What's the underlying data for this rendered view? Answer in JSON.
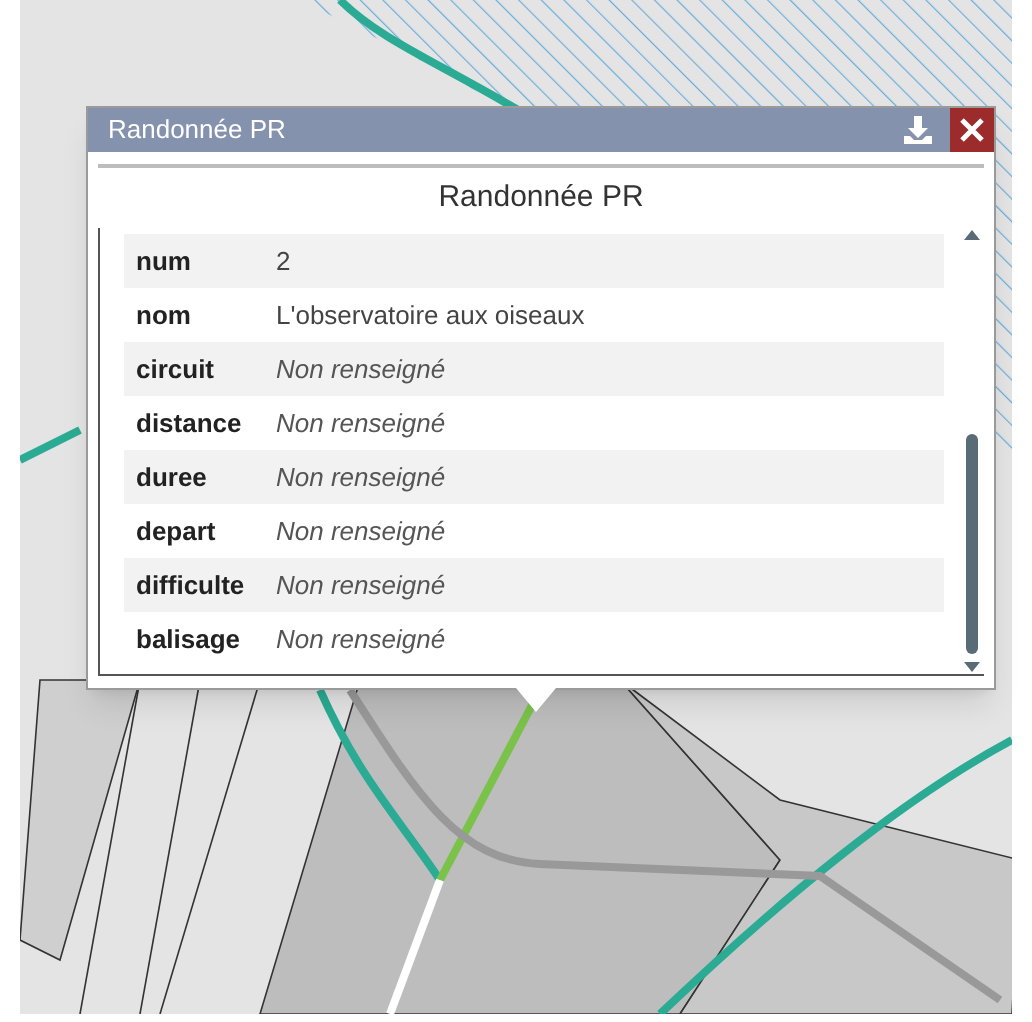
{
  "popup": {
    "title": "Randonnée PR",
    "heading": "Randonnée PR",
    "rows": [
      {
        "field": "num",
        "value": "2",
        "kind": "text"
      },
      {
        "field": "nom",
        "value": "L'observatoire aux oiseaux",
        "kind": "text"
      },
      {
        "field": "circuit",
        "value": "Non renseigné",
        "kind": "empty"
      },
      {
        "field": "distance",
        "value": "Non renseigné",
        "kind": "empty"
      },
      {
        "field": "duree",
        "value": "Non renseigné",
        "kind": "empty"
      },
      {
        "field": "depart",
        "value": "Non renseigné",
        "kind": "empty"
      },
      {
        "field": "difficulte",
        "value": "Non renseigné",
        "kind": "empty"
      },
      {
        "field": "balisage",
        "value": "Non renseigné",
        "kind": "empty"
      }
    ]
  }
}
